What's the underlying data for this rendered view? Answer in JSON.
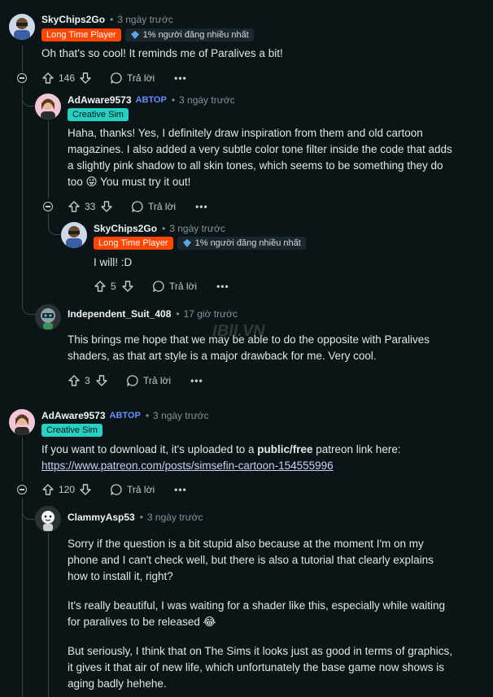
{
  "labels": {
    "reply": "Trả lời",
    "more": "•••",
    "dot": "•"
  },
  "colors": {
    "background": "#0b1416",
    "op": "#648efc",
    "flair_ltp": "#ff4500",
    "flair_cs": "#26d1c3"
  },
  "comments": [
    {
      "user": "SkyChips2Go",
      "time": "3 ngày trước",
      "flair1": "Long Time Player",
      "flair2": "1% người đăng nhiều nhất",
      "body": "Oh that's so cool! It reminds me of Paralives a bit!",
      "votes": "146"
    },
    {
      "user": "AdAware9573",
      "op": "ABTOP",
      "time": "3 ngày trước",
      "flair1": "Creative Sim",
      "body_lines": [
        "Haha, thanks! Yes, I definitely draw inspiration from them and old cartoon",
        "magazines. I also added a very subtle color tone filter inside the code that adds",
        "a slightly pink shadow to all skin tones, which seems to be something they do",
        "too 😜 You must try it out!"
      ],
      "votes": "33"
    },
    {
      "user": "SkyChips2Go",
      "time": "3 ngày trước",
      "flair1": "Long Time Player",
      "flair2": "1% người đăng nhiều nhất",
      "body": "I will! :D",
      "votes": "5"
    },
    {
      "user": "Independent_Suit_408",
      "time": "17 giờ trước",
      "body_lines": [
        "This brings me hope that we may be able to do the opposite with Paralives",
        "shaders, as that art style is a major drawback for me. Very cool."
      ],
      "votes": "3"
    },
    {
      "user": "AdAware9573",
      "op": "ABTOP",
      "time": "3 ngày trước",
      "flair1": "Creative Sim",
      "body_pre": "If you want to download it, it's uploaded to a ",
      "body_bold": "public/free",
      "body_post": " patreon link here:",
      "link": "https://www.patreon.com/posts/simsefin-cartoon-154555996",
      "votes": "120"
    },
    {
      "user": "ClammyAsp53",
      "time": "3 ngày trước",
      "para1": [
        "Sorry if the question is a bit stupid also because at the moment I'm on my",
        "phone and I can't check well, but there is also a tutorial that clearly explains",
        "how to install it, right?"
      ],
      "para2": [
        "It's really beautiful, I was waiting for a shader like this, especially while waiting",
        "for paralives to be released 😂"
      ],
      "para3": [
        "But seriously, I think that on The Sims it looks just as good in terms of graphics,",
        "it gives it that air of new life, which unfortunately the base game now shows is",
        "aging badly hehehe."
      ]
    }
  ],
  "watermark": "IBlI.VN"
}
